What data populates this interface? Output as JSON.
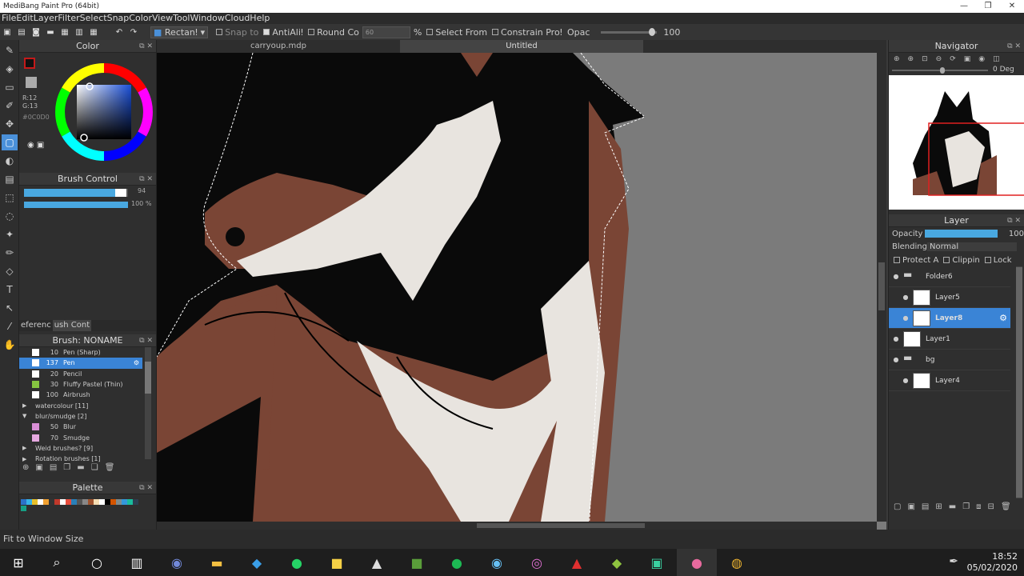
{
  "window": {
    "title": "MediBang Paint Pro (64bit)",
    "controls": [
      "—",
      "❐",
      "✕"
    ]
  },
  "menu": [
    "File",
    "Edit",
    "Layer",
    "Filter",
    "Select",
    "Snap",
    "Color",
    "View",
    "Tool",
    "Window",
    "Cloud",
    "Help"
  ],
  "tool_options": {
    "select_mode": "Rectanǃ",
    "snap_label": "Snap to",
    "antialias_label": "AntiAliǃ",
    "round_label": "Round Co",
    "round_value": "60",
    "percent": "%",
    "select_from_label": "Select From",
    "constrain_label": "Constrain Proǃ",
    "opacity_label": "Opac",
    "opacity_value": "100"
  },
  "color_panel": {
    "title": "Color",
    "r": "R:12",
    "g": "G:13",
    "hex": "#0C0D0",
    "fg_color": "#c41a1a"
  },
  "brush_control": {
    "title": "Brush Control",
    "size_value": "94",
    "opacity_value": "100 %",
    "size_fraction": 0.94,
    "opacity_fraction": 1.0
  },
  "tabs_small": [
    "eferenc",
    "ush Cont"
  ],
  "brush_list": {
    "title": "Brush: NONAME",
    "items": [
      {
        "size": "10",
        "name": "Pen (Sharp)",
        "color": "",
        "selected": false
      },
      {
        "size": "137",
        "name": "Pen",
        "color": "",
        "selected": true
      },
      {
        "size": "20",
        "name": "Pencil",
        "color": "",
        "selected": false
      },
      {
        "size": "30",
        "name": "Fluffy Pastel (Thin)",
        "color": "#86c440",
        "selected": false
      },
      {
        "size": "100",
        "name": "Airbrush",
        "color": "",
        "selected": false
      }
    ],
    "groups": [
      {
        "name": "watercolour [11]",
        "open": false
      },
      {
        "name": "blur/smudge [2]",
        "open": true
      }
    ],
    "sub_items": [
      {
        "size": "50",
        "name": "Blur",
        "color": "#d98fd6"
      },
      {
        "size": "70",
        "name": "Smudge",
        "color": "#e6a8e0"
      }
    ],
    "groups2": [
      {
        "name": "Weid brushes? [9]"
      },
      {
        "name": "Rotation brushes [1]"
      }
    ]
  },
  "palette": {
    "title": "Palette",
    "colors": [
      "#2b72c9",
      "#38b4e8",
      "#e8c02b",
      "#ffffff",
      "#f0a030",
      "#333",
      "#c0392b",
      "#fff",
      "#e74c3c",
      "#2980b9",
      "#555",
      "#888",
      "#a0522d",
      "#f5deb3",
      "#ffffff",
      "#000000",
      "#d35400",
      "#7f8c8d",
      "#3498db",
      "#1abc9c",
      "#2c3e50",
      "#16a085"
    ]
  },
  "canvas": {
    "tabs": [
      {
        "label": "carryoup.mdp",
        "active": false
      },
      {
        "label": "Untitled",
        "active": true
      }
    ]
  },
  "navigator": {
    "title": "Navigator",
    "angle": "0 Deg"
  },
  "layers": {
    "title": "Layer",
    "opacity_label": "Opacity",
    "opacity_value": "100",
    "blending_label": "Blending",
    "blending_value": "Normal",
    "protect_label": "Protect A",
    "clipping_label": "Clippin",
    "lock_label": "Lock",
    "items": [
      {
        "name": "Folder6",
        "type": "folder",
        "selected": false,
        "indent": 0
      },
      {
        "name": "Layer5",
        "type": "layer",
        "selected": false,
        "indent": 1
      },
      {
        "name": "Layer8",
        "type": "layer",
        "selected": true,
        "indent": 1
      },
      {
        "name": "Layer1",
        "type": "layer",
        "selected": false,
        "indent": 0
      },
      {
        "name": "bg",
        "type": "folder",
        "selected": false,
        "indent": 0
      },
      {
        "name": "Layer4",
        "type": "layer",
        "selected": false,
        "indent": 1
      }
    ]
  },
  "status": {
    "text": "Fit to Window Size"
  },
  "taskbar": {
    "time": "18:52",
    "date": "05/02/2020"
  }
}
